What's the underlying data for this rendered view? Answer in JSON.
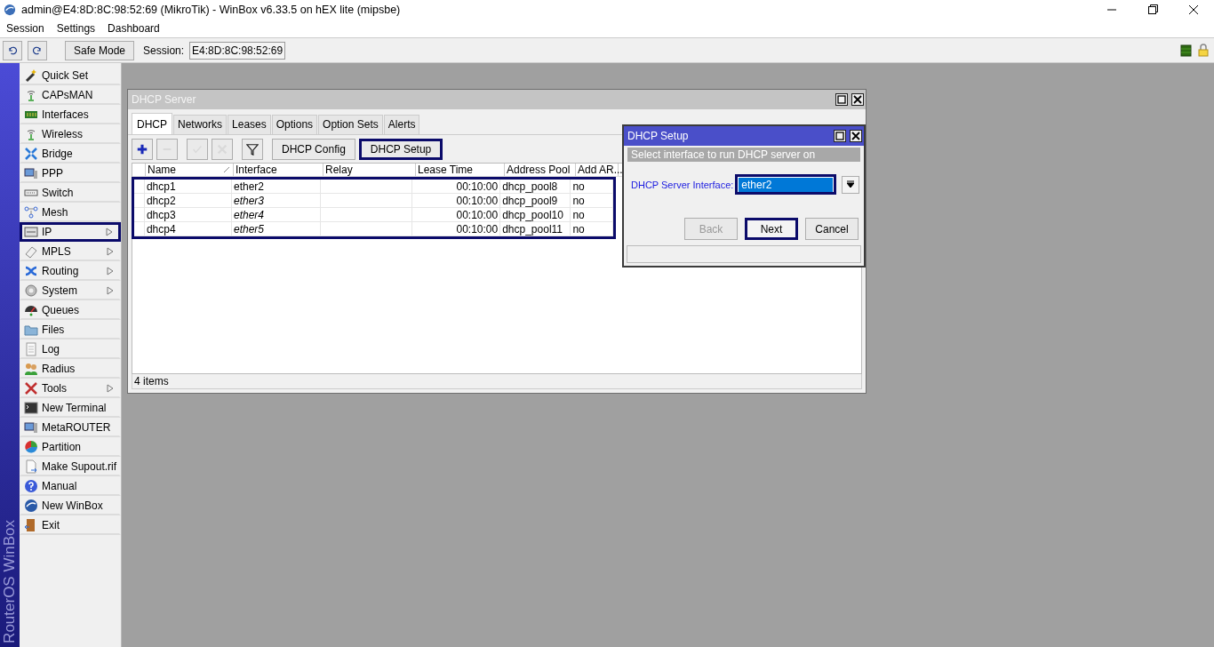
{
  "app": {
    "title": "admin@E4:8D:8C:98:52:69 (MikroTik) - WinBox v6.33.5 on hEX lite (mipsbe)"
  },
  "menu": [
    "Session",
    "Settings",
    "Dashboard"
  ],
  "toolbar": {
    "safe_mode": "Safe Mode",
    "session_label": "Session:",
    "session_value": "E4:8D:8C:98:52:69"
  },
  "sidebar": {
    "brand": "RouterOS WinBox",
    "items": [
      {
        "label": "Quick Set",
        "submenu": false,
        "highlighted": false
      },
      {
        "label": "CAPsMAN",
        "submenu": false,
        "highlighted": false
      },
      {
        "label": "Interfaces",
        "submenu": false,
        "highlighted": false
      },
      {
        "label": "Wireless",
        "submenu": false,
        "highlighted": false
      },
      {
        "label": "Bridge",
        "submenu": false,
        "highlighted": false
      },
      {
        "label": "PPP",
        "submenu": false,
        "highlighted": false
      },
      {
        "label": "Switch",
        "submenu": false,
        "highlighted": false
      },
      {
        "label": "Mesh",
        "submenu": false,
        "highlighted": false
      },
      {
        "label": "IP",
        "submenu": true,
        "highlighted": true
      },
      {
        "label": "MPLS",
        "submenu": true,
        "highlighted": false
      },
      {
        "label": "Routing",
        "submenu": true,
        "highlighted": false
      },
      {
        "label": "System",
        "submenu": true,
        "highlighted": false
      },
      {
        "label": "Queues",
        "submenu": false,
        "highlighted": false
      },
      {
        "label": "Files",
        "submenu": false,
        "highlighted": false
      },
      {
        "label": "Log",
        "submenu": false,
        "highlighted": false
      },
      {
        "label": "Radius",
        "submenu": false,
        "highlighted": false
      },
      {
        "label": "Tools",
        "submenu": true,
        "highlighted": false
      },
      {
        "label": "New Terminal",
        "submenu": false,
        "highlighted": false
      },
      {
        "label": "MetaROUTER",
        "submenu": false,
        "highlighted": false
      },
      {
        "label": "Partition",
        "submenu": false,
        "highlighted": false
      },
      {
        "label": "Make Supout.rif",
        "submenu": false,
        "highlighted": false
      },
      {
        "label": "Manual",
        "submenu": false,
        "highlighted": false
      },
      {
        "label": "New WinBox",
        "submenu": false,
        "highlighted": false
      },
      {
        "label": "Exit",
        "submenu": false,
        "highlighted": false
      }
    ]
  },
  "dhcp_server": {
    "title": "DHCP Server",
    "tabs": [
      {
        "label": "DHCP",
        "selected": true
      },
      {
        "label": "Networks",
        "selected": false
      },
      {
        "label": "Leases",
        "selected": false
      },
      {
        "label": "Options",
        "selected": false
      },
      {
        "label": "Option Sets",
        "selected": false
      },
      {
        "label": "Alerts",
        "selected": false
      }
    ],
    "tools": [
      {
        "kind": "add",
        "disabled": false,
        "highlighted": false
      },
      {
        "kind": "remove",
        "disabled": true,
        "highlighted": false
      },
      {
        "kind": "enable",
        "disabled": true,
        "highlighted": false
      },
      {
        "kind": "disable",
        "disabled": true,
        "highlighted": false
      },
      {
        "kind": "filter",
        "disabled": false,
        "highlighted": false
      },
      {
        "kind": "text",
        "label": "DHCP Config",
        "disabled": false,
        "highlighted": false
      },
      {
        "kind": "text",
        "label": "DHCP Setup",
        "disabled": false,
        "highlighted": true
      }
    ],
    "table": {
      "columns": [
        "Name",
        "Interface",
        "Relay",
        "Lease Time",
        "Address Pool",
        "Add AR..."
      ],
      "rows_highlighted": true,
      "rows": [
        {
          "name": "dhcp1",
          "interface": "ether2",
          "interface_inactive": false,
          "lease_time": "00:10:00",
          "address_pool": "dhcp_pool8",
          "add_arp": "no",
          "selected": false
        },
        {
          "name": "dhcp2",
          "interface": "ether3",
          "interface_inactive": true,
          "lease_time": "00:10:00",
          "address_pool": "dhcp_pool9",
          "add_arp": "no",
          "selected": false
        },
        {
          "name": "dhcp3",
          "interface": "ether4",
          "interface_inactive": true,
          "lease_time": "00:10:00",
          "address_pool": "dhcp_pool10",
          "add_arp": "no",
          "selected": false
        },
        {
          "name": "dhcp4",
          "interface": "ether5",
          "interface_inactive": true,
          "lease_time": "00:10:00",
          "address_pool": "dhcp_pool11",
          "add_arp": "no",
          "selected": false
        }
      ]
    },
    "status_bar": "4 items"
  },
  "dhcp_setup": {
    "title": "DHCP Setup",
    "subtitle": "Select interface to run DHCP server on",
    "field_label": "DHCP Server Interface:",
    "field_value": "ether2",
    "value_selected": true,
    "field_highlighted": true,
    "buttons": [
      {
        "label": "Back",
        "disabled": true,
        "highlighted": false
      },
      {
        "label": "Next",
        "disabled": false,
        "highlighted": true
      },
      {
        "label": "Cancel",
        "disabled": false,
        "highlighted": false
      }
    ]
  }
}
